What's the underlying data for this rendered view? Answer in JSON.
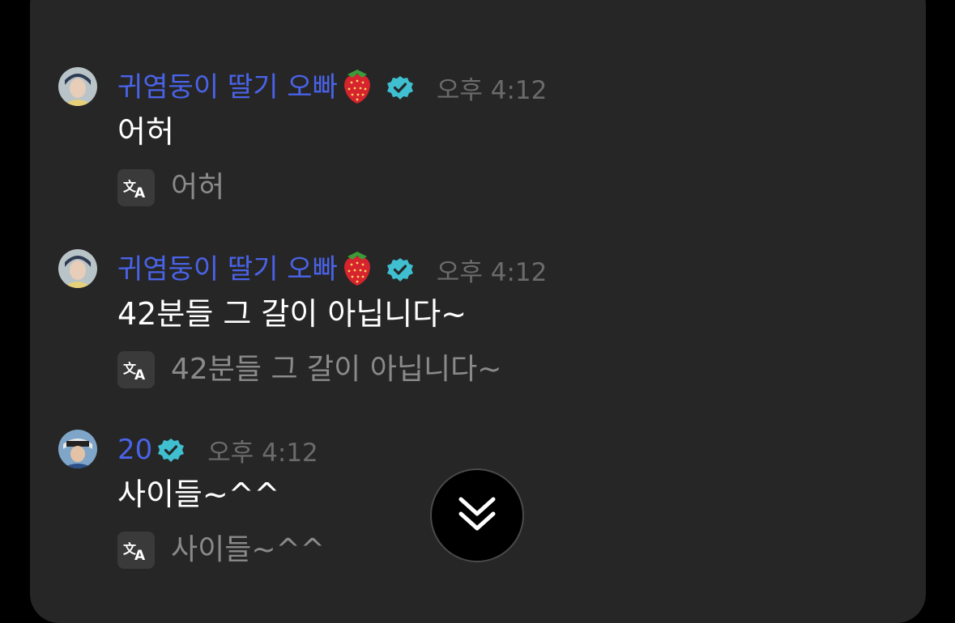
{
  "colors": {
    "background": "#000000",
    "panel": "#262626",
    "username": "#4a63e8",
    "verified_badge": "#3fbfd0",
    "timestamp": "#6b6b6b",
    "message_text": "#ffffff",
    "translation_text": "#8a8a8a",
    "translate_icon_bg": "#3a3a3a"
  },
  "messages": [
    {
      "username": "귀염둥이 딸기 오빠",
      "emoji": "strawberry",
      "verified": true,
      "time": "오후 4:12",
      "text": "어허",
      "translation": "어허"
    },
    {
      "username": "귀염둥이 딸기 오빠",
      "emoji": "strawberry",
      "verified": true,
      "time": "오후 4:12",
      "text": "42분들 그 갈이 아닙니다~",
      "translation": "42분들 그 갈이 아닙니다~"
    },
    {
      "username": "20",
      "verified": true,
      "time": "오후 4:12",
      "text": "사이들~^^",
      "translation": "사이들~^^"
    }
  ],
  "icons": {
    "translate": "translate-icon",
    "verified": "verified-badge-icon",
    "scroll": "double-chevron-down-icon"
  }
}
